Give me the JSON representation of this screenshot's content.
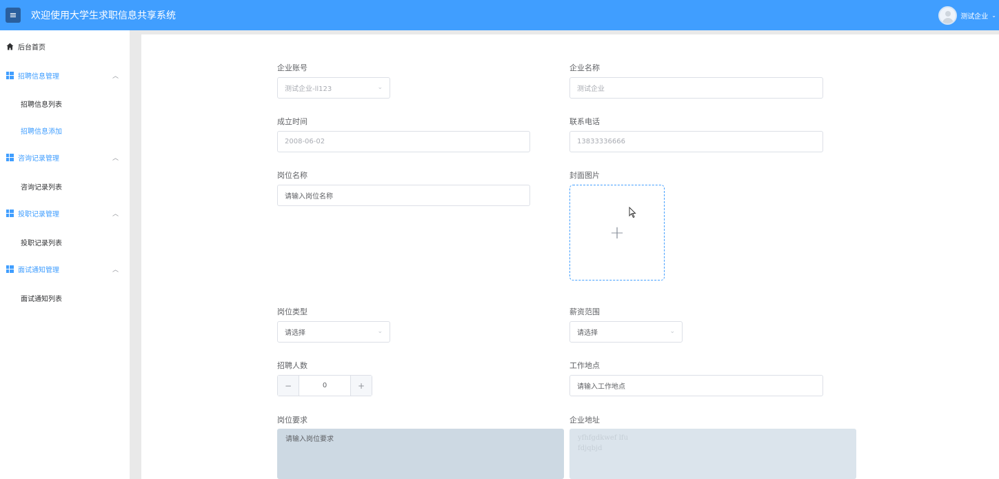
{
  "header": {
    "menu_icon": "≡",
    "title": "欢迎使用大学生求职信息共享系统",
    "user_name": "测试企业",
    "caret": "⌄"
  },
  "sidebar": {
    "home": "后台首页",
    "groups": [
      {
        "label": "招聘信息管理",
        "subs": [
          "招聘信息列表",
          "招聘信息添加"
        ]
      },
      {
        "label": "咨询记录管理",
        "subs": [
          "咨询记录列表"
        ]
      },
      {
        "label": "投职记录管理",
        "subs": [
          "投职记录列表"
        ]
      },
      {
        "label": "面试通知管理",
        "subs": [
          "面试通知列表"
        ]
      }
    ],
    "active_sub": "招聘信息添加"
  },
  "form": {
    "company_account": {
      "label": "企业账号",
      "value": "测试企业-ll123"
    },
    "company_name": {
      "label": "企业名称",
      "value": "测试企业"
    },
    "founded": {
      "label": "成立时间",
      "value": "2008-06-02"
    },
    "phone": {
      "label": "联系电话",
      "value": "13833336666"
    },
    "position_name": {
      "label": "岗位名称",
      "placeholder": "请输入岗位名称"
    },
    "cover_image": {
      "label": "封面图片",
      "icon": "plus-icon"
    },
    "position_type": {
      "label": "岗位类型",
      "placeholder": "请选择"
    },
    "salary_range": {
      "label": "薪资范围",
      "placeholder": "请选择"
    },
    "headcount": {
      "label": "招聘人数",
      "value": "0",
      "minus": "−",
      "plus": "+"
    },
    "work_location": {
      "label": "工作地点",
      "placeholder": "请输入工作地点"
    },
    "requirements": {
      "label": "岗位要求",
      "placeholder": "请输入岗位要求"
    },
    "company_address": {
      "label": "企业地址",
      "value_line1": "yfhfgdkwef lfu",
      "value_line2": "fdjqbjd"
    }
  },
  "colors": {
    "header": "#409eff",
    "accent": "#409eff",
    "sidebar_bg": "#ffffff",
    "page_bg": "#e9e9e9"
  }
}
